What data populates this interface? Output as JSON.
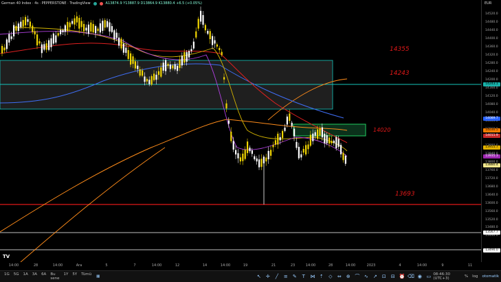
{
  "header": {
    "title": "German 40 Index · 4s · PEPPERSTONE · TradingView",
    "ohlc": "A13874.9 Y13887.9 D13864.9 K13880.4 +6.5 (+0.05%)"
  },
  "price_axis": {
    "currency": "EUR",
    "ticks": [
      "14520.0",
      "14480.0",
      "14440.0",
      "14400.0",
      "14360.0",
      "14320.0",
      "14280.0",
      "14240.0",
      "14200.0",
      "14160.0",
      "14120.0",
      "14080.0",
      "14040.0",
      "14000.0",
      "13960.0",
      "13920.0",
      "13880.0",
      "13840.0",
      "13800.0",
      "13760.0",
      "13720.0",
      "13680.0",
      "13640.0",
      "13600.0",
      "13560.0",
      "13520.0",
      "13480.0",
      "13440.0"
    ],
    "badges": [
      {
        "label": "14243.1",
        "bg": "#18b0a8",
        "fg": "#000"
      },
      {
        "label": "14089.7",
        "bg": "#2962ff",
        "fg": "#fff"
      },
      {
        "label": "14030.5",
        "bg": "#f57c00",
        "fg": "#000"
      },
      {
        "label": "14011.9",
        "bg": "#c62828",
        "fg": "#fff"
      },
      {
        "label": "13955.7",
        "bg": "#e0b000",
        "fg": "#000"
      },
      {
        "label": "13935.3",
        "bg": "#9c27b0",
        "fg": "#fff"
      },
      {
        "label": "13880.4",
        "bg": "#f0e68c",
        "fg": "#000"
      },
      {
        "label": "13567.7",
        "bg": "#ffffff",
        "fg": "#000"
      },
      {
        "label": "13490.0",
        "bg": "#ffffff",
        "fg": "#000"
      }
    ]
  },
  "levels": {
    "l1": "14355",
    "l2": "14243",
    "l3": "14020",
    "l4": "13693"
  },
  "time_axis": [
    "14:00",
    "28",
    "14:00",
    "Ara",
    "5",
    "7",
    "14:00",
    "12",
    "14",
    "14:00",
    "19",
    "21",
    "23",
    "14:00",
    "28",
    "14:00",
    "2023",
    "4",
    "14:00",
    "9",
    "11"
  ],
  "bottom_bar": {
    "timeframes": [
      "1G",
      "5G",
      "1A",
      "3A",
      "6A",
      "Bu sene",
      "1Y",
      "5Y",
      "Tümü"
    ],
    "clock": "08:46:30 (UTC+3)",
    "percent": "%",
    "log": "log",
    "auto": "otomatik"
  },
  "colors": {
    "bull": "#f2d602",
    "bear": "#ffffff",
    "teal": "#16c6bd",
    "red_line": "#e01818"
  }
}
